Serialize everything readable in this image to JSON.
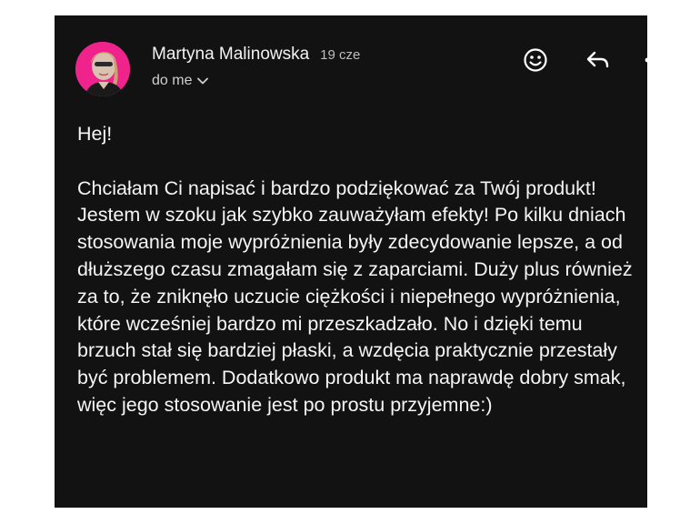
{
  "message": {
    "sender_name": "Martyna Malinowska",
    "date": "19 cze",
    "recipient": "do me",
    "greeting": "Hej!",
    "line1": "Chciałam Ci napisać i bardzo podziękować za Twój produkt!",
    "line2": "Jestem w szoku jak szybko zauważyłam efekty! Po kilku dniach stosowania moje wypróżnienia były zdecydowanie lepsze, a od dłuższego czasu zmagałam się z zaparciami. Duży plus również za to, że zniknęło uczucie ciężkości i niepełnego wypróżnienia, które wcześniej bardzo mi przeszkadzało. No i dzięki temu brzuch stał się bardziej płaski, a wzdęcia praktycznie przestały być problemem. Dodatkowo produkt ma naprawdę dobry smak, więc jego stosowanie jest po prostu przyjemne:)"
  },
  "icons": {
    "expand": "chevron-down-icon",
    "react": "smiley-icon",
    "reply": "reply-arrow-icon",
    "more": "more-horizontal-icon"
  },
  "colors": {
    "background": "#121212",
    "avatar_ring": "#f0238c",
    "text": "#f5f5f5",
    "secondary_text": "#bdbdbd"
  }
}
